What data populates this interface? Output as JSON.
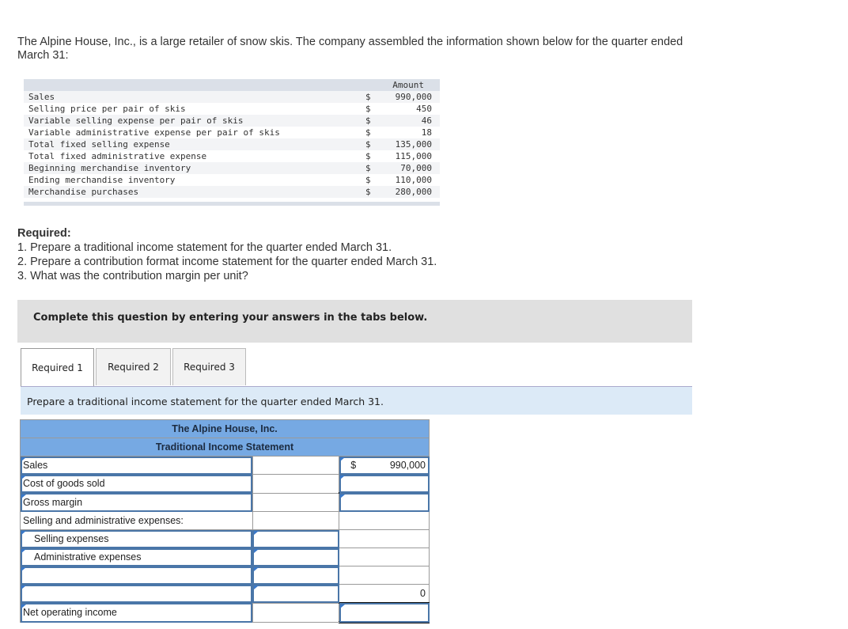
{
  "intro": {
    "line1": "The Alpine House, Inc., is a large retailer of snow skis. The company assembled the information shown below for the quarter ended",
    "line2": "March 31:"
  },
  "given": {
    "header": "Amount",
    "rows": [
      {
        "label": "Sales",
        "dollar": "$",
        "amount": "990,000"
      },
      {
        "label": "Selling price per pair of skis",
        "dollar": "$",
        "amount": "450"
      },
      {
        "label": "Variable selling expense per pair of skis",
        "dollar": "$",
        "amount": "46"
      },
      {
        "label": "Variable administrative expense per pair of skis",
        "dollar": "$",
        "amount": "18"
      },
      {
        "label": "Total fixed selling expense",
        "dollar": "$",
        "amount": "135,000"
      },
      {
        "label": "Total fixed administrative expense",
        "dollar": "$",
        "amount": "115,000"
      },
      {
        "label": "Beginning merchandise inventory",
        "dollar": "$",
        "amount": "70,000"
      },
      {
        "label": "Ending merchandise inventory",
        "dollar": "$",
        "amount": "110,000"
      },
      {
        "label": "Merchandise purchases",
        "dollar": "$",
        "amount": "280,000"
      }
    ]
  },
  "required": {
    "title": "Required:",
    "items": [
      "1. Prepare a traditional income statement for the quarter ended March 31.",
      "2. Prepare a contribution format income statement for the quarter ended March 31.",
      "3. What was the contribution margin per unit?"
    ]
  },
  "banner": "Complete this question by entering your answers in the tabs below.",
  "tabs": [
    {
      "label": "Required 1",
      "active": true
    },
    {
      "label": "Required 2",
      "active": false
    },
    {
      "label": "Required 3",
      "active": false
    }
  ],
  "prompt": "Prepare a traditional income statement for the quarter ended March 31.",
  "statement": {
    "company": "The Alpine House, Inc.",
    "title": "Traditional Income Statement",
    "rows": [
      {
        "label": "Sales",
        "col2": "",
        "dollar": "$",
        "col3": "990,000"
      },
      {
        "label": "Cost of goods sold",
        "col2": "",
        "col3": ""
      },
      {
        "label": "Gross margin",
        "col2": "",
        "col3": ""
      },
      {
        "label": "Selling and administrative expenses:",
        "col2": "",
        "col3": ""
      },
      {
        "label": "Selling expenses",
        "col2": "",
        "col3": ""
      },
      {
        "label": "Administrative expenses",
        "col2": "",
        "col3": ""
      },
      {
        "label": "",
        "col2": "",
        "col3": ""
      },
      {
        "label": "",
        "col2": "",
        "col3": "0"
      },
      {
        "label": "Net operating income",
        "col2": "",
        "col3": ""
      }
    ]
  }
}
